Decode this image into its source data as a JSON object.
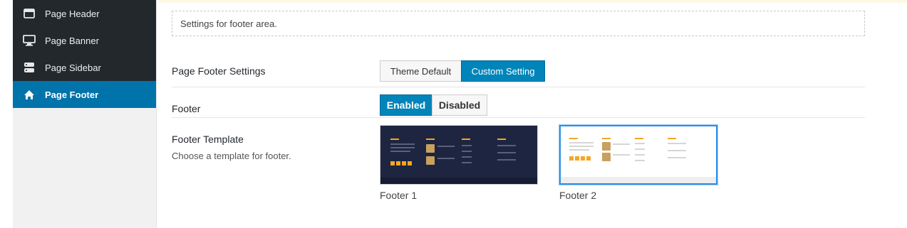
{
  "sidebar": {
    "items": [
      {
        "label": "Page Header",
        "icon": "window-icon"
      },
      {
        "label": "Page Banner",
        "icon": "monitor-icon"
      },
      {
        "label": "Page Sidebar",
        "icon": "server-icon"
      },
      {
        "label": "Page Footer",
        "icon": "home-icon",
        "active": true
      }
    ]
  },
  "main": {
    "description": "Settings for footer area.",
    "footer_settings": {
      "label": "Page Footer Settings",
      "options": [
        "Theme Default",
        "Custom Setting"
      ],
      "selected": "Custom Setting"
    },
    "footer": {
      "label": "Footer",
      "options": [
        "Enabled",
        "Disabled"
      ],
      "selected": "Enabled"
    },
    "footer_template": {
      "label": "Footer Template",
      "description": "Choose a template for footer.",
      "templates": [
        {
          "caption": "Footer 1",
          "style": "dark"
        },
        {
          "caption": "Footer 2",
          "style": "light",
          "selected": true
        }
      ]
    }
  },
  "colors": {
    "sidebar_dark": "#23282d",
    "active_blue": "#0073aa",
    "button_blue": "#0085ba",
    "template_dark": "#1d2540",
    "accent_orange": "#f5a623"
  }
}
